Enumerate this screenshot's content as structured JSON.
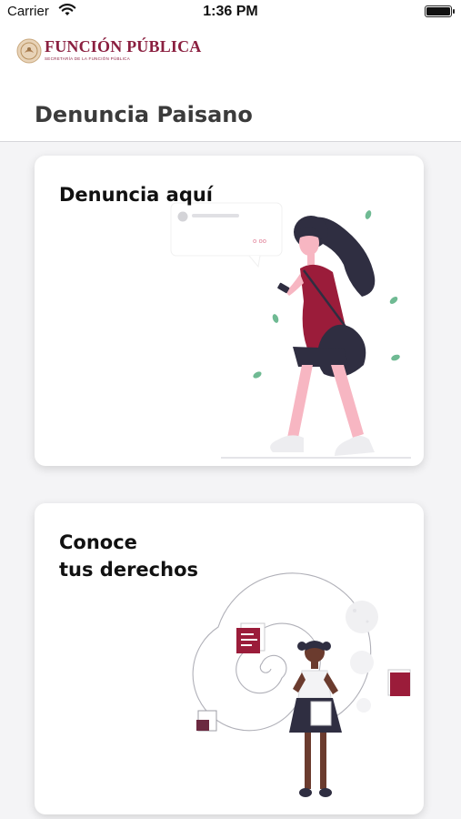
{
  "status_bar": {
    "carrier": "Carrier",
    "time": "1:36 PM"
  },
  "header": {
    "logo_text": "FUNCIÓN PÚBLICA",
    "logo_subtitle": "SECRETARÍA DE LA FUNCIÓN PÚBLICA",
    "title": "Denuncia Paisano"
  },
  "cards": [
    {
      "title": "Denuncia aquí",
      "illustration": "woman-walking-phone"
    },
    {
      "title_line1": "Conoce",
      "title_line2": "tus derechos",
      "illustration": "girl-spiral-documents"
    }
  ],
  "bubble_text": "o oo",
  "colors": {
    "brand": "#8b2040",
    "accent": "#9b1c3a",
    "dark": "#2f2e41",
    "leaf": "#6fba93",
    "skin": "#f7b6c2"
  }
}
